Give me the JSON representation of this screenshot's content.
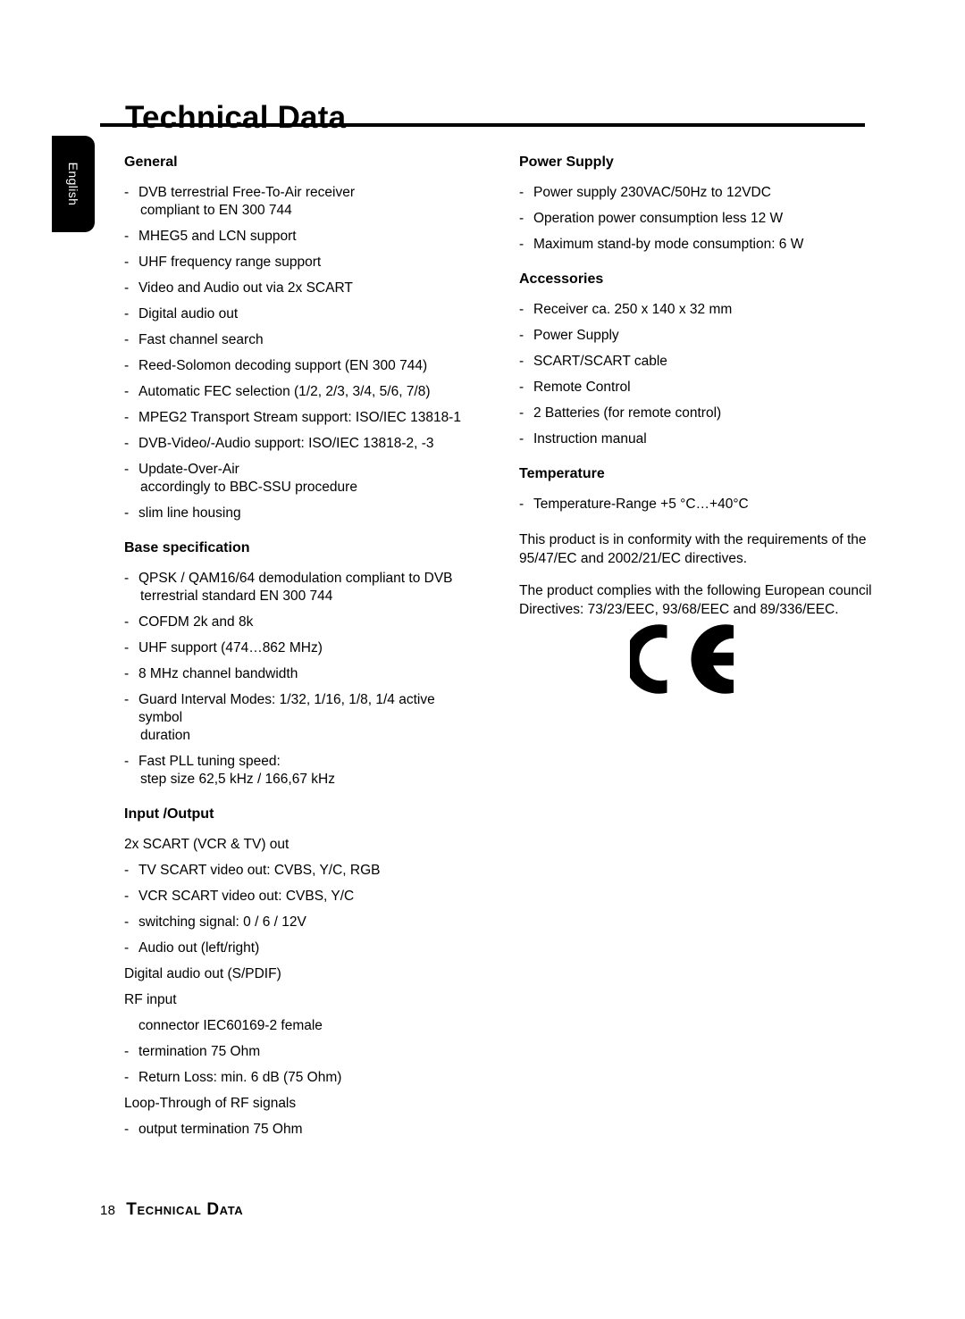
{
  "page": {
    "title": "Technical Data",
    "language_tab": "English",
    "footer": {
      "page_number": "18",
      "title": "Technical Data"
    }
  },
  "left_column": [
    {
      "heading": "General",
      "items": [
        {
          "dash": true,
          "text": "DVB terrestrial Free-To-Air receiver",
          "cont": "compliant to EN 300 744"
        },
        {
          "dash": true,
          "text": "MHEG5 and LCN support"
        },
        {
          "dash": true,
          "text": "UHF frequency range support"
        },
        {
          "dash": true,
          "text": "Video and Audio out via 2x SCART"
        },
        {
          "dash": true,
          "text": "Digital audio out"
        },
        {
          "dash": true,
          "text": "Fast channel search"
        },
        {
          "dash": true,
          "text": "Reed-Solomon decoding support (EN 300 744)"
        },
        {
          "dash": true,
          "text": "Automatic FEC selection (1/2, 2/3, 3/4, 5/6, 7/8)"
        },
        {
          "dash": true,
          "text": "MPEG2 Transport Stream support: ISO/IEC 13818-1"
        },
        {
          "dash": true,
          "text": "DVB-Video/-Audio support: ISO/IEC 13818-2, -3"
        },
        {
          "dash": true,
          "text": "Update-Over-Air",
          "cont": "accordingly to BBC-SSU procedure"
        },
        {
          "dash": true,
          "text": "slim line housing"
        }
      ]
    },
    {
      "heading": "Base specification",
      "items": [
        {
          "dash": true,
          "text": "QPSK / QAM16/64 demodulation compliant to DVB",
          "cont": "terrestrial standard EN 300 744"
        },
        {
          "dash": true,
          "text": "COFDM 2k and 8k"
        },
        {
          "dash": true,
          "text": "UHF support (474…862 MHz)"
        },
        {
          "dash": true,
          "text": "8 MHz channel bandwidth"
        },
        {
          "dash": true,
          "text": "Guard Interval Modes: 1/32, 1/16, 1/8, 1/4 active symbol",
          "cont": "duration"
        },
        {
          "dash": true,
          "text": "Fast PLL tuning speed:",
          "cont": "step size 62,5 kHz / 166,67 kHz"
        }
      ]
    },
    {
      "heading": "Input /Output",
      "items": [
        {
          "dash": false,
          "text": "2x SCART (VCR & TV) out"
        },
        {
          "dash": true,
          "text": "TV SCART video out: CVBS, Y/C, RGB"
        },
        {
          "dash": true,
          "text": "VCR SCART video out: CVBS, Y/C"
        },
        {
          "dash": true,
          "text": "switching signal: 0 / 6 / 12V"
        },
        {
          "dash": true,
          "text": "Audio out (left/right)"
        },
        {
          "dash": false,
          "text": "Digital audio out (S/PDIF)"
        },
        {
          "dash": false,
          "text": "RF input"
        },
        {
          "dash": false,
          "indent": true,
          "text": "connector IEC60169-2 female"
        },
        {
          "dash": true,
          "text": "termination 75 Ohm"
        },
        {
          "dash": true,
          "text": "Return Loss: min. 6 dB (75 Ohm)"
        },
        {
          "dash": false,
          "text": "Loop-Through of RF signals"
        },
        {
          "dash": true,
          "text": "output termination 75 Ohm"
        }
      ]
    }
  ],
  "right_column": [
    {
      "heading": "Power Supply",
      "items": [
        {
          "dash": true,
          "text": "Power supply 230VAC/50Hz to 12VDC"
        },
        {
          "dash": true,
          "text": "Operation power consumption less 12 W"
        },
        {
          "dash": true,
          "text": "Maximum stand-by mode consumption: 6 W"
        }
      ]
    },
    {
      "heading": "Accessories",
      "items": [
        {
          "dash": true,
          "text": "Receiver ca. 250 x 140 x 32 mm"
        },
        {
          "dash": true,
          "text": "Power Supply"
        },
        {
          "dash": true,
          "text": "SCART/SCART cable"
        },
        {
          "dash": true,
          "text": "Remote Control"
        },
        {
          "dash": true,
          "text": "2 Batteries (for remote control)"
        },
        {
          "dash": true,
          "text": "Instruction manual"
        }
      ]
    },
    {
      "heading": "Temperature",
      "items": [
        {
          "dash": true,
          "text": "Temperature-Range +5 °C…+40°C"
        }
      ]
    }
  ],
  "conformity_paragraphs": [
    "This product is in conformity with the requirements of the 95/47/EC and 2002/21/EC directives.",
    "The product complies with the following European council Directives: 73/23/EEC, 93/68/EEC and 89/336/EEC."
  ],
  "ce_mark": {
    "name": "ce-marking",
    "label": "CE",
    "color": "#000000"
  },
  "dash_glyph": "-"
}
